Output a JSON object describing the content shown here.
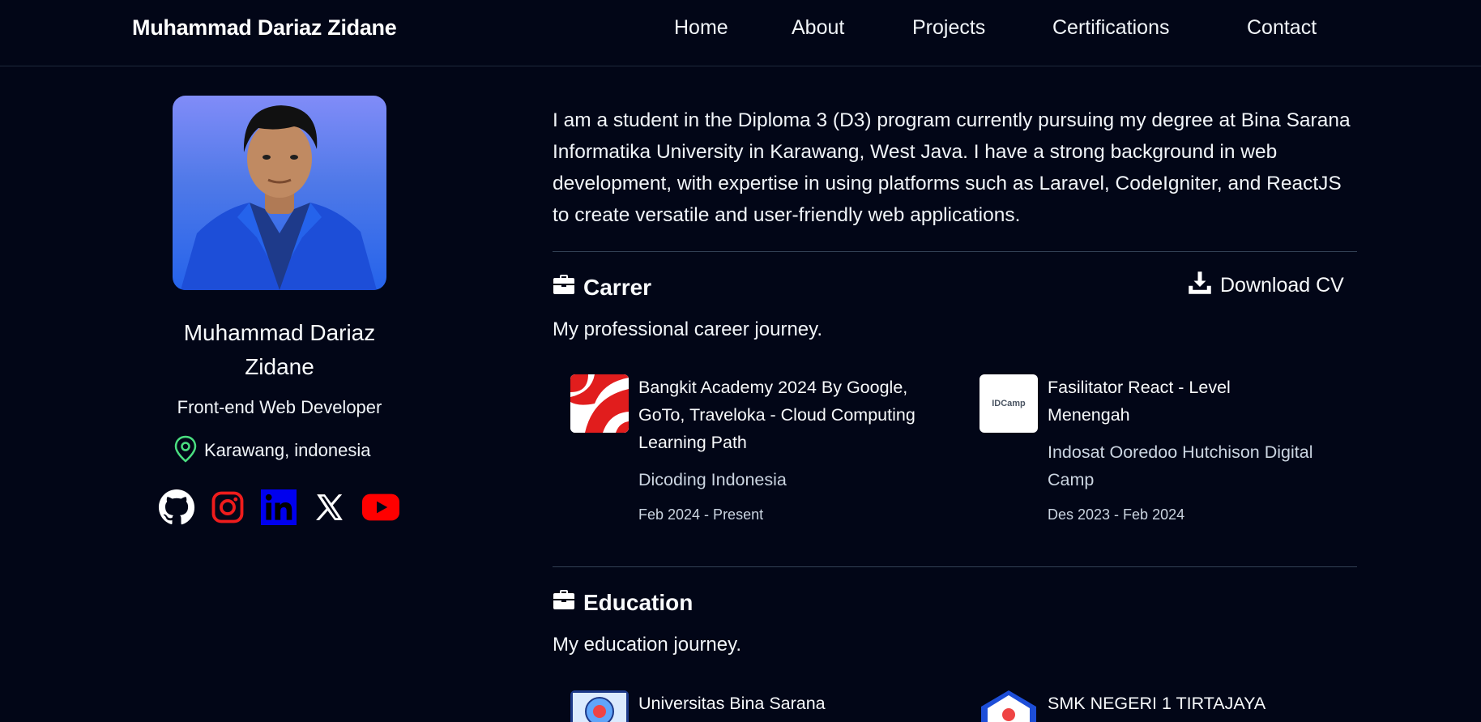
{
  "header": {
    "brand": "Muhammad Dariaz Zidane",
    "nav": [
      "Home",
      "About",
      "Projects",
      "Certifications",
      "Contact"
    ]
  },
  "profile": {
    "name": "Muhammad Dariaz Zidane",
    "role": "Front-end Web Developer",
    "location": "Karawang, indonesia",
    "socials": [
      {
        "name": "github",
        "icon": "github-icon",
        "color": "#ffffff"
      },
      {
        "name": "instagram",
        "icon": "instagram-icon",
        "color": "#ef1c1c"
      },
      {
        "name": "linkedin",
        "icon": "linkedin-icon",
        "color": "#0000ee"
      },
      {
        "name": "x",
        "icon": "x-icon",
        "color": "#ffffff"
      },
      {
        "name": "youtube",
        "icon": "youtube-icon",
        "color": "#ff0000"
      }
    ]
  },
  "intro": "I am a student in the Diploma 3 (D3) program currently pursuing my degree at Bina Sarana Informatika University in Karawang, West Java. I have a strong background in web development, with expertise in using platforms such as Laravel, CodeIgniter, and ReactJS to create versatile and user-friendly web applications.",
  "career": {
    "title": "Carrer",
    "subtitle": "My professional career journey.",
    "download_label": "Download CV",
    "items": [
      {
        "title": "Bangkit Academy 2024 By Google, GoTo, Traveloka - Cloud Computing Learning Path",
        "org": "Dicoding Indonesia",
        "date": "Feb 2024 - Present",
        "logo": "bangkit-logo"
      },
      {
        "title": "Fasilitator React - Level Menengah",
        "org": "Indosat Ooredoo Hutchison Digital Camp",
        "date": "Des 2023 - Feb 2024",
        "logo": "idcamp-logo",
        "logo_text": "IDCamp"
      }
    ]
  },
  "education": {
    "title": "Education",
    "subtitle": "My education journey.",
    "items": [
      {
        "title": "Universitas Bina Sarana",
        "logo": "ubsi-logo"
      },
      {
        "title": "SMK NEGERI 1 TIRTAJAYA",
        "logo": "smkn-logo"
      }
    ]
  },
  "colors": {
    "background": "#020617",
    "divider": "#334155",
    "location_pin": "#4ade80"
  }
}
